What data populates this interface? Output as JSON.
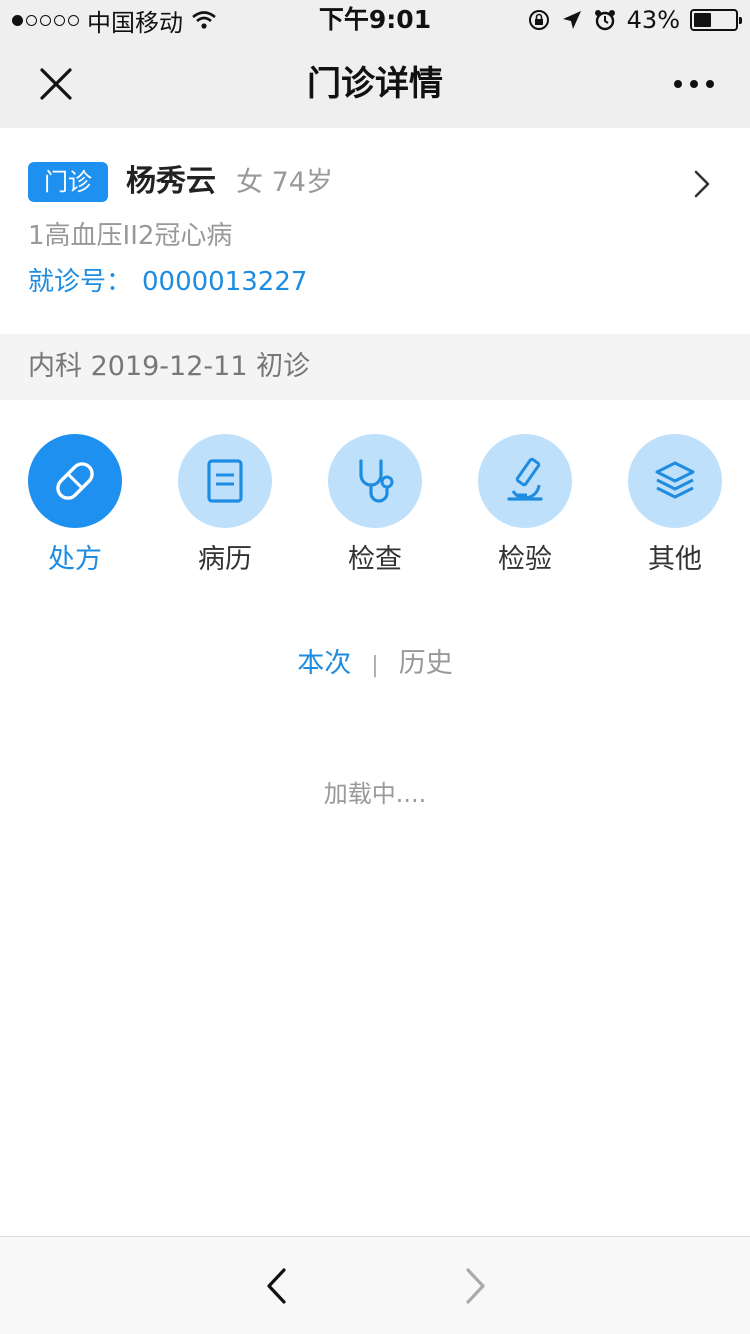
{
  "status_bar": {
    "carrier": "中国移动",
    "time": "下午9:01",
    "battery_percent": "43%",
    "battery_level": 0.43
  },
  "nav": {
    "title": "门诊详情"
  },
  "patient": {
    "badge": "门诊",
    "name": "杨秀云",
    "meta": "女 74岁",
    "diagnosis": "1高血压II2冠心病",
    "visit_no_label": "就诊号：",
    "visit_no": "0000013227"
  },
  "visit_info": "内科 2019-12-11 初诊",
  "categories": [
    {
      "label": "处方",
      "icon": "pill-icon",
      "active": true
    },
    {
      "label": "病历",
      "icon": "document-icon",
      "active": false
    },
    {
      "label": "检查",
      "icon": "stethoscope-icon",
      "active": false
    },
    {
      "label": "检验",
      "icon": "microscope-icon",
      "active": false
    },
    {
      "label": "其他",
      "icon": "layers-icon",
      "active": false
    }
  ],
  "tabs": {
    "current": "本次",
    "separator": "|",
    "history": "历史"
  },
  "loading_text": "加载中....",
  "colors": {
    "accent": "#1e90f0",
    "icon_bg": "#bfe0fb",
    "nav_bg": "#efefef"
  }
}
